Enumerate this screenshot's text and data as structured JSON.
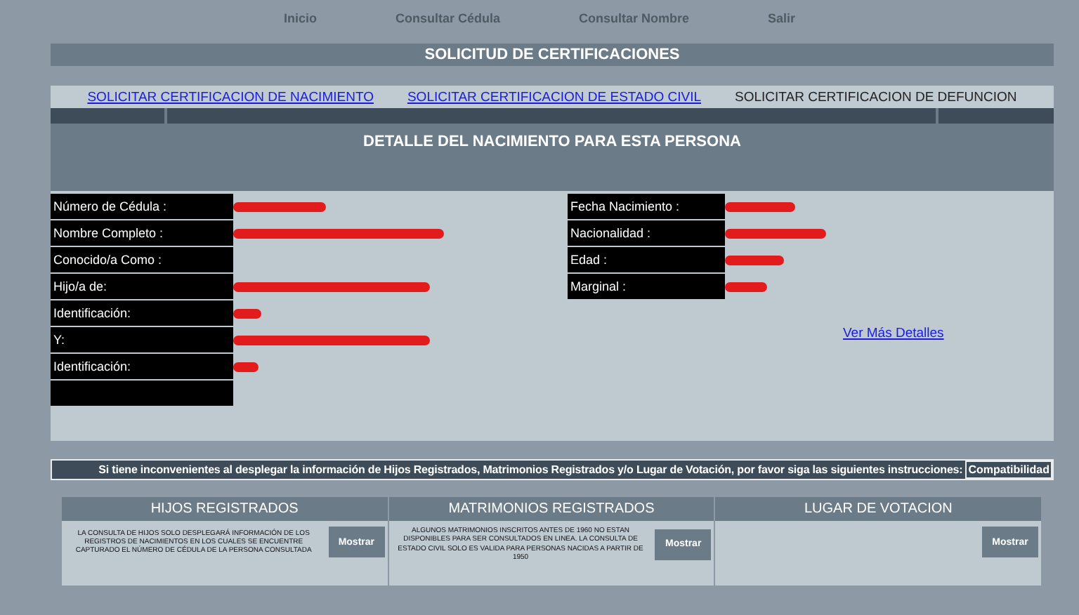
{
  "nav": [
    "Inicio",
    "Consultar Cédula",
    "Consultar Nombre",
    "Salir"
  ],
  "title": "SOLICITUD DE CERTIFICACIONES",
  "links": [
    {
      "label": "SOLICITAR CERTIFICACION DE NACIMIENTO",
      "selected": false
    },
    {
      "label": "SOLICITAR CERTIFICACION DE ESTADO CIVIL",
      "selected": false
    },
    {
      "label": "SOLICITAR CERTIFICACION DE DEFUNCION",
      "selected": true
    }
  ],
  "detail_title": "DETALLE DEL NACIMIENTO PARA ESTA PERSONA",
  "left_fields": [
    {
      "label": "Número de Cédula :",
      "redacted": true
    },
    {
      "label": "Nombre Completo :",
      "redacted": true
    },
    {
      "label": "Conocido/a Como :",
      "redacted": false
    },
    {
      "label": "Hijo/a de:",
      "redacted": true
    },
    {
      "label": "Identificación:",
      "redacted": true
    },
    {
      "label": "Y:",
      "redacted": true
    },
    {
      "label": "Identificación:",
      "redacted": true
    },
    {
      "redacted": false
    }
  ],
  "right_fields": [
    {
      "label": "Fecha Nacimiento :",
      "redacted": true
    },
    {
      "label": "Nacionalidad :",
      "redacted": true
    },
    {
      "label": "Edad :",
      "redacted": true
    },
    {
      "label": "Marginal :",
      "redacted": true
    }
  ],
  "more_link": "Ver Más Detalles",
  "notice": "Si tiene inconvenientes al desplegar la información de Hijos Registrados, Matrimonios Registrados y/o Lugar de Votación, por favor siga las siguientes instrucciones:",
  "notice_button": "Compatibilidad",
  "sections": [
    {
      "title": "HIJOS REGISTRADOS",
      "text": "LA CONSULTA DE HIJOS SOLO DESPLEGARÁ INFORMACIÓN DE LOS REGISTROS DE NACIMIENTOS EN LOS CUALES SE ENCUENTRE CAPTURADO EL NÚMERO DE CÉDULA DE LA PERSONA CONSULTADA",
      "button": "Mostrar"
    },
    {
      "title": "MATRIMONIOS REGISTRADOS",
      "text": "ALGUNOS MATRIMONIOS INSCRITOS ANTES DE 1960 NO ESTAN DISPONIBLES PARA SER CONSULTADOS EN LINEA. LA CONSULTA DE ESTADO CIVIL SOLO ES VALIDA PARA PERSONAS NACIDAS A PARTIR DE 1950",
      "button": "Mostrar"
    },
    {
      "title": "LUGAR DE VOTACION",
      "button": "Mostrar"
    }
  ]
}
